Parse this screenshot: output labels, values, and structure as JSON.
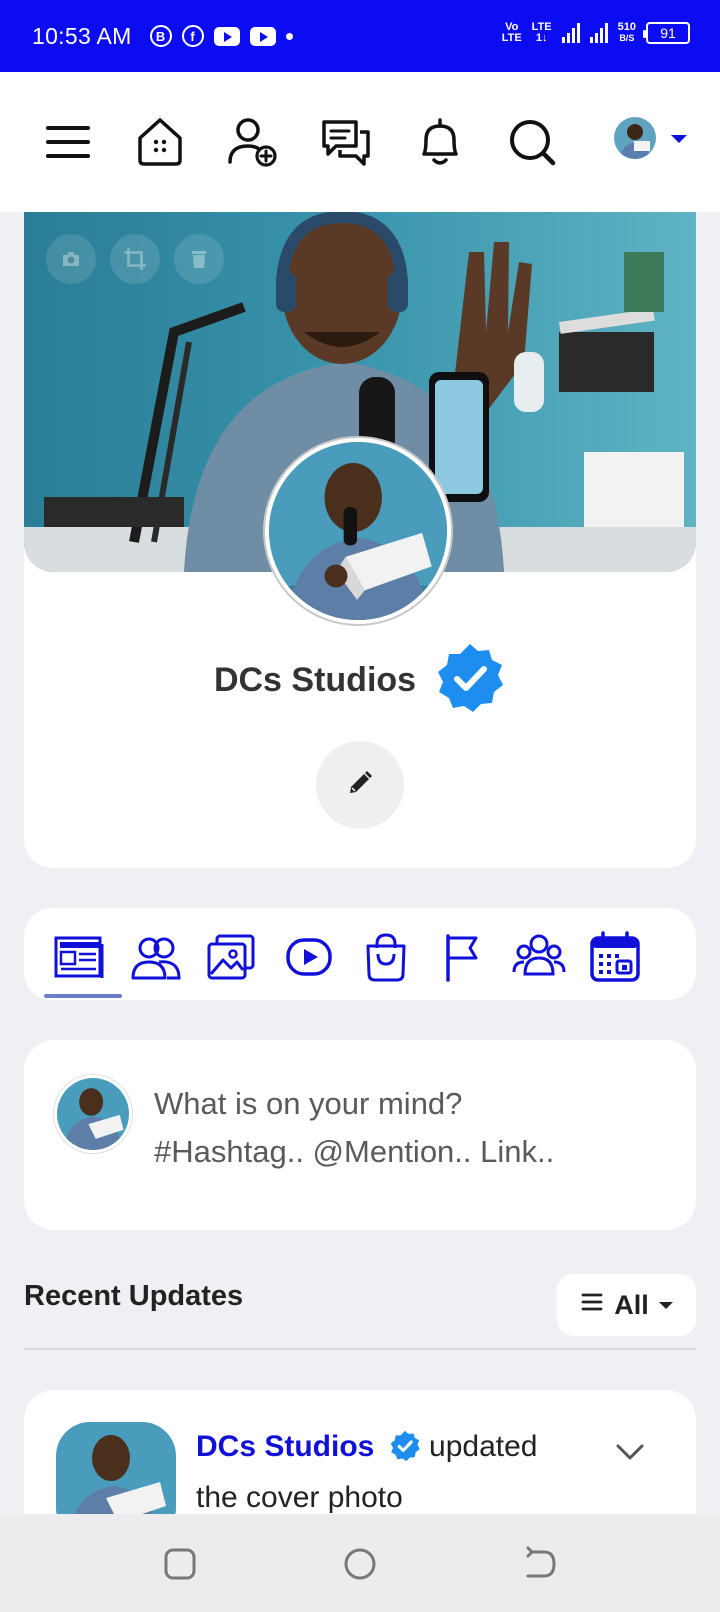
{
  "status_bar": {
    "time": "10:53 AM",
    "app_icons": [
      "b-icon",
      "facebook-icon",
      "youtube-icon",
      "youtube-icon"
    ],
    "net_top": "Vo",
    "net_bottom": "LTE",
    "lte_top": "LTE",
    "lte_bottom": "1↓",
    "speed_value": "510",
    "speed_unit": "B/S",
    "battery": "91"
  },
  "top_nav": {
    "icons": [
      "menu-icon",
      "home-icon",
      "add-friend-icon",
      "messages-icon",
      "notifications-icon",
      "search-icon"
    ],
    "accent": "#1010e0"
  },
  "profile": {
    "name": "DCs Studios",
    "verified_color": "#1d8ef0",
    "cover_tools": [
      "camera-icon",
      "crop-icon",
      "delete-icon"
    ]
  },
  "tabs": {
    "items": [
      "timeline-icon",
      "friends-icon",
      "photos-icon",
      "videos-icon",
      "shop-icon",
      "pages-icon",
      "groups-icon",
      "events-icon"
    ],
    "active_index": 0
  },
  "composer": {
    "placeholder_line1": "What is on your mind?",
    "placeholder_line2": "#Hashtag.. @Mention.. Link.."
  },
  "recent": {
    "title": "Recent Updates",
    "filter_label": "All"
  },
  "post": {
    "author": "DCs Studios",
    "action": " updated",
    "action_line2": "the cover photo"
  }
}
